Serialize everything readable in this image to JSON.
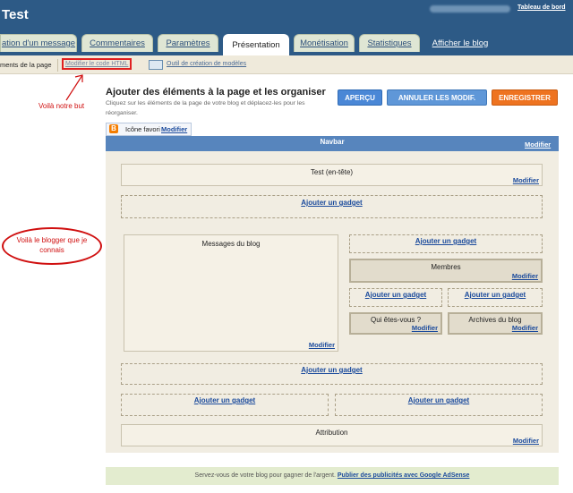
{
  "header": {
    "blog_title": "Test",
    "dashboard_link": "Tableau de bord"
  },
  "tabs": [
    {
      "label": "ation d'un message"
    },
    {
      "label": "Commentaires"
    },
    {
      "label": "Paramètres"
    },
    {
      "label": "Présentation"
    },
    {
      "label": "Monétisation"
    },
    {
      "label": "Statistiques"
    },
    {
      "label": "Afficher le blog"
    }
  ],
  "subnav": {
    "elements_label": "ments de la page",
    "edit_html": "Modifier le code HTML",
    "template_tool": "Outil de création de modèles"
  },
  "annotations": {
    "target": "Voilà notre but",
    "blogger": "Voilà le blogger que je connais"
  },
  "main": {
    "title": "Ajouter des éléments à la page et les organiser",
    "description": "Cliquez sur les éléments de la page de votre blog et déplacez-les pour les réorganiser.",
    "preview_button": "APERÇU",
    "cancel_button": "ANNULER LES MODIF.",
    "save_button": "ENREGISTRER"
  },
  "favicon": {
    "label": "Icône favori",
    "edit": "Modifier"
  },
  "navbar": {
    "label": "Navbar",
    "edit": "Modifier"
  },
  "layout": {
    "header_title": "Test (en-tête)",
    "edit": "Modifier",
    "add_gadget": "Ajouter un gadget",
    "blog_posts": "Messages du blog",
    "members": "Membres",
    "about_me": "Qui êtes-vous ?",
    "archives": "Archives du blog",
    "attribution": "Attribution"
  },
  "footer": {
    "ads_text": "Servez-vous de votre blog pour gagner de l'argent.",
    "ads_link": "Publier des publicités avec Google AdSense"
  },
  "colors": {
    "header_bg": "#2d5a86",
    "navbar_bg": "#5785bd",
    "save_button": "#ee7320",
    "preview_button": "#4a87d6",
    "annotation": "#d01010"
  }
}
